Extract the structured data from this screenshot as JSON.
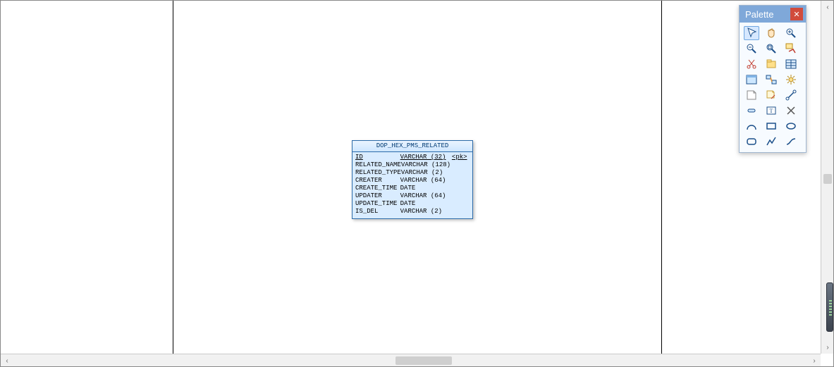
{
  "palette": {
    "title": "Palette",
    "tools": [
      [
        "select-cursor",
        "pan-hand",
        "zoom-in"
      ],
      [
        "zoom-out",
        "zoom-fit",
        "zoom-region"
      ],
      [
        "cut",
        "package",
        "table-entity"
      ],
      [
        "entity",
        "dependency",
        "settings"
      ],
      [
        "note",
        "link-note",
        "attach-link"
      ],
      [
        "column-tool",
        "text-box",
        "delete-tool"
      ],
      [
        "line-arc",
        "rectangle",
        "ellipse"
      ],
      [
        "rounded-rect",
        "polyline",
        "curve"
      ]
    ]
  },
  "entity": {
    "name": "DOP_HEX_PMS_RELATED",
    "pk_marker": "<pk>",
    "columns": [
      {
        "name": "ID",
        "type": "VARCHAR (32)",
        "pk": true
      },
      {
        "name": "RELATED_NAME",
        "type": "VARCHAR (128)",
        "pk": false
      },
      {
        "name": "RELATED_TYPE",
        "type": "VARCHAR (2)",
        "pk": false
      },
      {
        "name": "CREATER",
        "type": "VARCHAR (64)",
        "pk": false
      },
      {
        "name": "CREATE_TIME",
        "type": "DATE",
        "pk": false
      },
      {
        "name": "UPDATER",
        "type": "VARCHAR (64)",
        "pk": false
      },
      {
        "name": "UPDATE_TIME",
        "type": "DATE",
        "pk": false
      },
      {
        "name": "IS_DEL",
        "type": "VARCHAR (2)",
        "pk": false
      }
    ]
  }
}
